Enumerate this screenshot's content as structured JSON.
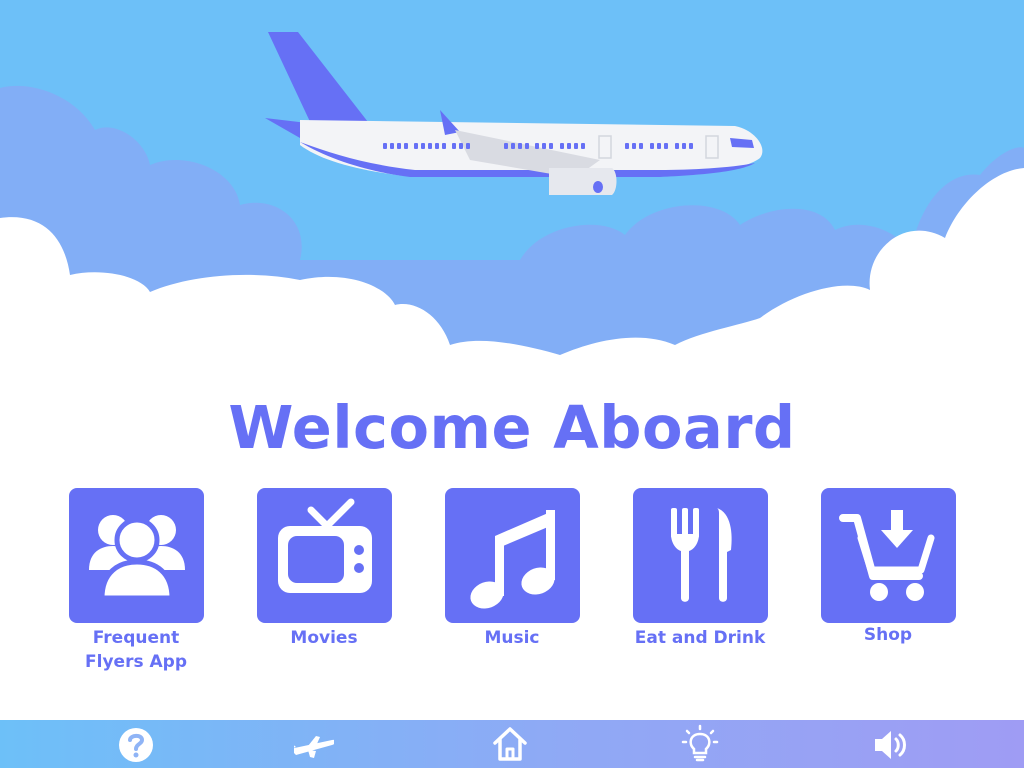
{
  "colors": {
    "sky": "#6dc0f8",
    "cloud_back": "#82aef6",
    "cloud_front": "#ffffff",
    "accent": "#6670f5",
    "plane_body": "#f3f4f7"
  },
  "hero": {
    "image": "airplane-flying-above-clouds"
  },
  "welcome": {
    "title": "Welcome Aboard"
  },
  "menu": {
    "items": [
      {
        "id": "frequent-flyers",
        "label": "Frequent\nFlyers App",
        "icon": "users-icon"
      },
      {
        "id": "movies",
        "label": "Movies",
        "icon": "tv-icon"
      },
      {
        "id": "music",
        "label": "Music",
        "icon": "music-note-icon"
      },
      {
        "id": "eat-and-drink",
        "label": "Eat and Drink",
        "icon": "fork-knife-icon"
      },
      {
        "id": "shop",
        "label": "Shop",
        "icon": "shopping-cart-icon"
      }
    ]
  },
  "bottom_bar": {
    "buttons": [
      {
        "id": "help",
        "icon": "help-icon"
      },
      {
        "id": "flight",
        "icon": "airplane-icon"
      },
      {
        "id": "home",
        "icon": "home-icon"
      },
      {
        "id": "light",
        "icon": "light-bulb-icon"
      },
      {
        "id": "volume",
        "icon": "speaker-icon"
      }
    ]
  }
}
